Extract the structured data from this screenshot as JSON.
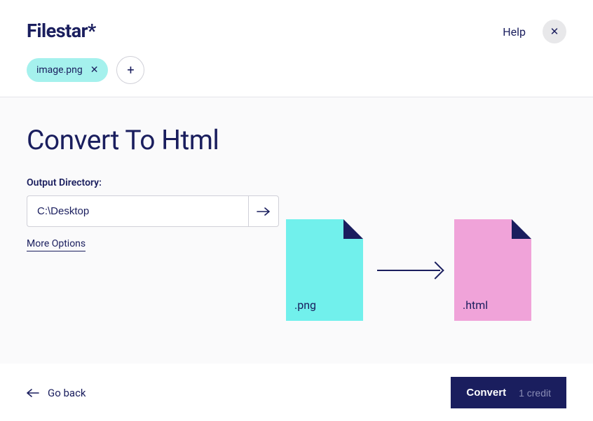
{
  "app": {
    "logo_text": "Filestar*",
    "help_label": "Help"
  },
  "files": {
    "current_file": "image.png"
  },
  "main": {
    "title": "Convert To Html",
    "output_label": "Output Directory:",
    "output_value": "C:\\Desktop",
    "more_options_label": "More Options"
  },
  "illustration": {
    "source_ext": ".png",
    "target_ext": ".html"
  },
  "footer": {
    "go_back_label": "Go back",
    "convert_label": "Convert",
    "credit_cost": "1 credit"
  }
}
